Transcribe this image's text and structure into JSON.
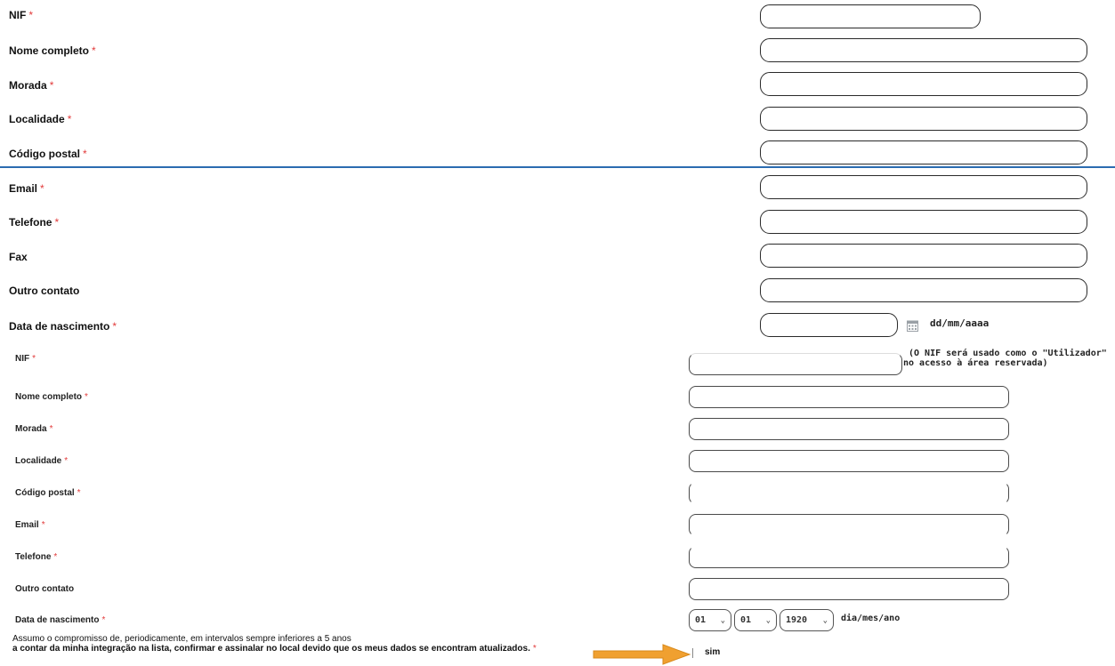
{
  "required_mark": "*",
  "form1": {
    "fields": [
      {
        "label": "NIF",
        "required": true
      },
      {
        "label": "Nome completo",
        "required": true
      },
      {
        "label": "Morada",
        "required": true
      },
      {
        "label": "Localidade",
        "required": true
      },
      {
        "label": "Código postal",
        "required": true
      },
      {
        "label": "Email",
        "required": true
      },
      {
        "label": "Telefone",
        "required": true
      },
      {
        "label": "Fax",
        "required": false
      },
      {
        "label": "Outro contato",
        "required": false
      },
      {
        "label": "Data de nascimento",
        "required": true
      }
    ],
    "date_format_hint": "dd/mm/aaaa"
  },
  "form2": {
    "fields": [
      {
        "label": "NIF",
        "required": true
      },
      {
        "label": "Nome completo",
        "required": true
      },
      {
        "label": "Morada",
        "required": true
      },
      {
        "label": "Localidade",
        "required": true
      },
      {
        "label": "Código postal",
        "required": true
      },
      {
        "label": "Email",
        "required": true
      },
      {
        "label": "Telefone",
        "required": true
      },
      {
        "label": "Outro contato",
        "required": false
      },
      {
        "label": "Data de nascimento",
        "required": true
      }
    ],
    "nif_note_line1": "(O NIF será usado como o \"Utilizador\"",
    "nif_note_line2": "no acesso à área reservada)",
    "dob": {
      "day": "01",
      "month": "01",
      "year": "1920",
      "format_hint": "dia/mes/ano"
    }
  },
  "consent": {
    "line1": "Assumo o compromisso de, periodicamente, em intervalos sempre inferiores a 5 anos",
    "line2": "a contar da minha integração na lista, confirmar e assinalar no local devido que os meus dados se encontram atualizados.",
    "checkbox_label": "sim"
  },
  "colors": {
    "divider": "#2b6cb0",
    "required": "#e23b3b",
    "arrow": "#f0a030"
  },
  "icons": {
    "calendar": "calendar-icon",
    "arrow": "arrow-right-icon",
    "chevron": "chevron-down-icon"
  }
}
